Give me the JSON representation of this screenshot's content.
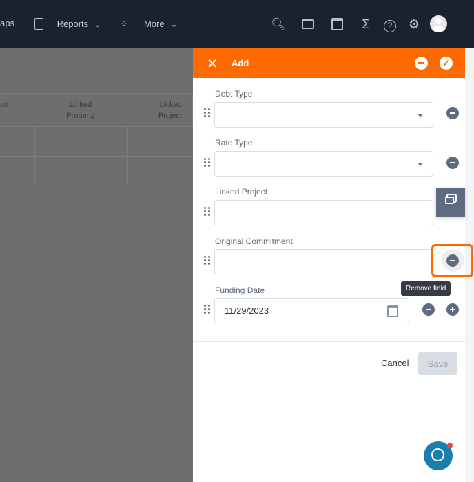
{
  "topbar": {
    "nav": [
      {
        "label": "aps",
        "icon": "map-icon"
      },
      {
        "label": "Reports",
        "icon": "report-icon"
      },
      {
        "label": "More",
        "icon": "grid-icon"
      }
    ],
    "icons": [
      "search-icon",
      "folder-icon",
      "calendar-icon",
      "sigma-icon",
      "help-icon",
      "gear-icon",
      "avatar"
    ]
  },
  "table": {
    "headers": [
      "on",
      "Linked\nProperty",
      "Linked\nProject"
    ]
  },
  "panel": {
    "title": "Add",
    "fields": [
      {
        "label": "Debt Type",
        "type": "select",
        "value": ""
      },
      {
        "label": "Rate Type",
        "type": "select",
        "value": ""
      },
      {
        "label": "Linked Project",
        "type": "text",
        "value": ""
      },
      {
        "label": "Original Commitment",
        "type": "text",
        "value": ""
      },
      {
        "label": "Funding Date",
        "type": "date",
        "value": "11/29/2023"
      }
    ],
    "tooltip": "Remove field",
    "cancel_label": "Cancel",
    "save_label": "Save"
  },
  "colors": {
    "accent": "#ff6a00",
    "topbar": "#1c2130",
    "icon": "#5f6b80"
  }
}
